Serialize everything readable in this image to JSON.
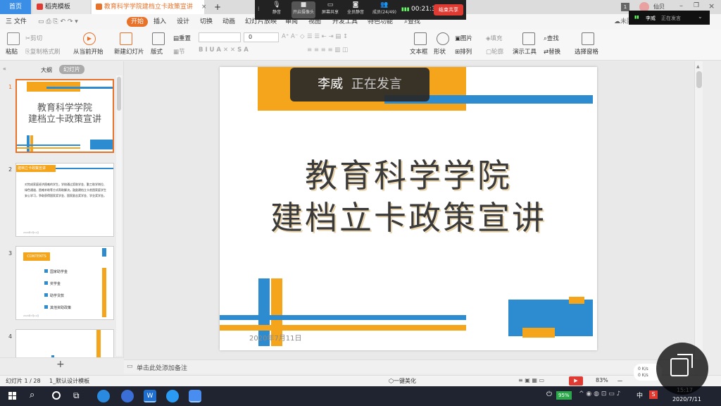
{
  "tabs": {
    "home": "首页",
    "template": "稻壳模板",
    "document": "教育科学学院建档立卡政策宣讲",
    "add": "+"
  },
  "menu": {
    "file": "三 文件",
    "items": [
      "开始",
      "插入",
      "设计",
      "切换",
      "动画",
      "幻灯片放映",
      "审阅",
      "视图",
      "开发工具",
      "特色功能"
    ],
    "search": "查找",
    "active": "开始",
    "user": "仙贝",
    "cloud": "未同"
  },
  "ribbon": {
    "paste": "粘贴",
    "cut": "剪切",
    "copy": "复制",
    "format_painter": "格式刷",
    "from_current": "从当前开始",
    "new_slide": "新建幻灯片",
    "layout": "版式",
    "section": "节",
    "reset": "重置",
    "font_size": "0",
    "text_box": "文本框",
    "shape": "形状",
    "arrange": "排列",
    "picture": "图片",
    "fill": "填充",
    "outline": "轮廓",
    "present_tools": "演示工具",
    "find": "查找",
    "replace": "替换",
    "select_pane": "选择窗格"
  },
  "left_panel": {
    "outline_tab": "大纲",
    "slides_tab": "幻灯片",
    "slide_numbers": [
      "1",
      "2",
      "3",
      "4"
    ],
    "thumb1_line1": "教育科学学院",
    "thumb1_line2": "建档立卡政策宣讲",
    "thumb2_title": "建档立卡政策宣讲",
    "thumb2_body": "对完成家庭经济困难的学生，学校通过奖助学金、勤工助学岗位、绿色通道、困难补助等方式帮助解决。鼓励建档立卡贫困家庭学生安心学习，争取获得国家奖学金、国家励志奖学金、学业奖学金。",
    "thumb2_date": "2020年7月11日",
    "thumb3_title": "CONTENTS",
    "thumb3_items": [
      "国家助学金",
      "奖学金",
      "助学贷款",
      "其他资助政策"
    ],
    "thumb3_date": "2020年7月11日",
    "add_button": "+"
  },
  "slide": {
    "title_line1": "教育科学学院",
    "title_line2": "建档立卡政策宣讲",
    "date": "2020年7月11日"
  },
  "speaker_banner": {
    "name": "李威",
    "status": "正在发言"
  },
  "meeting_bar": {
    "mute": "静音",
    "camera": "开启摄像头",
    "share": "屏幕共享",
    "members": "全员静音",
    "member_count": "成员(24/49)",
    "timer": "00:21:36",
    "end": "结束共享"
  },
  "overlay": {
    "name": "李威",
    "status": "正在发言"
  },
  "notes": {
    "placeholder": "单击此处添加备注"
  },
  "status": {
    "slide_count": "幻灯片 1 / 28",
    "theme": "1_默认设计模板",
    "beautify": "一键美化",
    "zoom": "83%",
    "zoom_minus": "－",
    "net_up": "0  K/s",
    "net_down": "0  K/s"
  },
  "taskbar": {
    "battery": "95%",
    "time": "15:17",
    "date": "2020/7/11",
    "ime": "中"
  },
  "colors": {
    "accent": "#f4a51c",
    "blue": "#2d8ccf",
    "wps_orange": "#e8722a",
    "red": "#e03b32"
  }
}
